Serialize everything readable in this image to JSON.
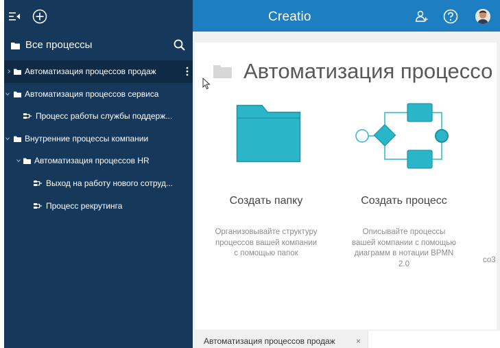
{
  "header": {
    "brand": "Creatio"
  },
  "sidebar": {
    "title": "Все процессы",
    "items": [
      {
        "label": "Автоматизация процессов продаж",
        "kind": "folder",
        "expanded": false,
        "selected": true
      },
      {
        "label": "Автоматизация процессов сервиса",
        "kind": "folder",
        "expanded": true,
        "selected": false
      },
      {
        "label": "Процесс работы службы поддерж...",
        "kind": "process",
        "selected": false
      },
      {
        "label": "Внутренние процессы компании",
        "kind": "folder",
        "expanded": true,
        "selected": false
      },
      {
        "label": "Автоматизация процессов HR",
        "kind": "folder",
        "expanded": true,
        "selected": false
      },
      {
        "label": "Выход на работу нового сотруд...",
        "kind": "process",
        "selected": false
      },
      {
        "label": "Процесс рекрутинга",
        "kind": "process",
        "selected": false
      }
    ]
  },
  "main": {
    "title": "Автоматизация процессо",
    "tiles": [
      {
        "title": "Создать папку",
        "description_lines": [
          "Организовывайте структуру",
          "процессов вашей компании",
          "с помощью папок"
        ]
      },
      {
        "title": "Создать процесс",
        "description_lines": [
          "Описывайте процессы",
          "вашей компании с помощью",
          "диаграмм в нотации BPMN",
          "2.0"
        ]
      }
    ],
    "partial_text": "со3"
  },
  "bottom_tabs": [
    {
      "label": "Автоматизация процессов продаж",
      "close": "×"
    }
  ],
  "colors": {
    "sidebar_bg": "#16385a",
    "topbar_bg": "#1d7fc1",
    "accent_teal": "#2bb5c8"
  }
}
